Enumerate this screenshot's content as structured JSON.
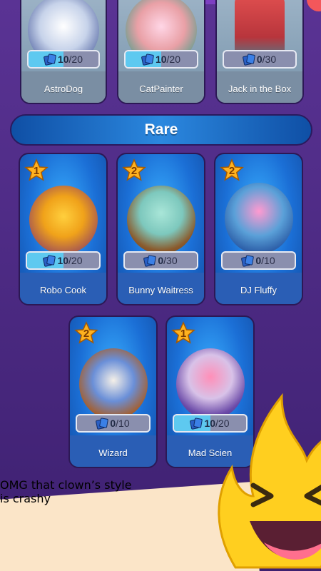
{
  "colors": {
    "background": "#4a2b86",
    "rare_card": "#1b6fd6",
    "common_card": "#8ea6ba",
    "progress_fill": "#5ec9f0",
    "star": "#ffb21f",
    "promo_band": "#fbe5c8",
    "promo_text": "#8a2a1a",
    "mascot": "#ffcf1f"
  },
  "top_row": [
    {
      "name": "AstroDog",
      "count": "10",
      "total": "/20",
      "progress": 0.5
    },
    {
      "name": "CatPainter",
      "count": "10",
      "total": "/20",
      "progress": 0.5
    },
    {
      "name": "Jack in the Box",
      "count": "0",
      "total": "/30",
      "progress": 0.0
    }
  ],
  "rare_section": {
    "title": "Rare",
    "cards": [
      {
        "name": "Robo Cook",
        "level": "1",
        "count": "10",
        "total": "/20",
        "progress": 0.5
      },
      {
        "name": "Bunny Waitress",
        "level": "2",
        "count": "0",
        "total": "/30",
        "progress": 0.0
      },
      {
        "name": "DJ Fluffy",
        "level": "2",
        "count": "0",
        "total": "/10",
        "progress": 0.0
      },
      {
        "name": "Wizard",
        "level": "2",
        "count": "0",
        "total": "/10",
        "progress": 0.0
      },
      {
        "name": "Mad Scien",
        "level": "1",
        "count": "10",
        "total": "/20",
        "progress": 0.5
      }
    ]
  },
  "promo": {
    "line1": "OMG that clown’s style",
    "line2": "is crashy"
  },
  "icons": {
    "card_count": "cards-icon",
    "level": "star-icon",
    "mascot": "flame-mascot-icon"
  }
}
